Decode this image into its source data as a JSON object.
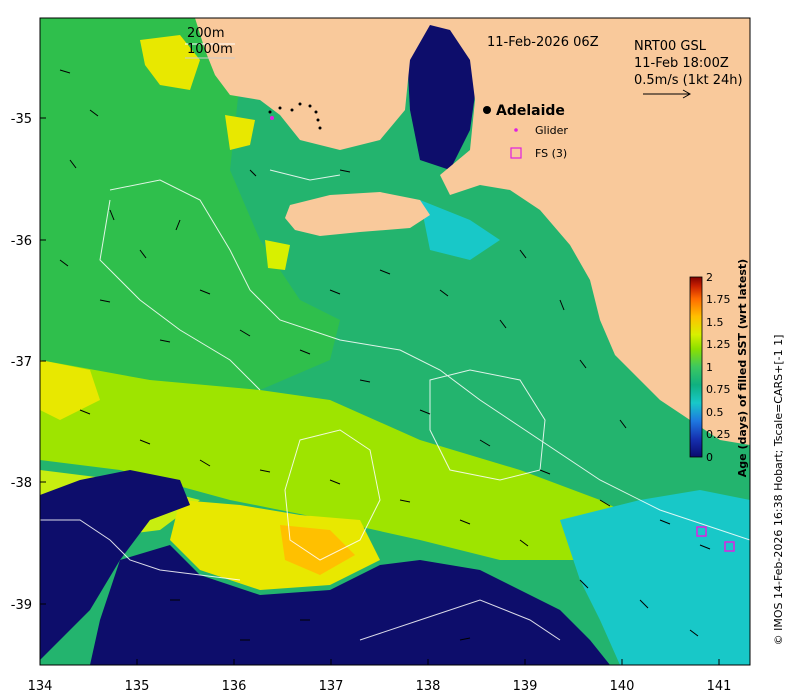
{
  "map": {
    "title_date": "11-Feb-2026 06Z",
    "product": "NRT00 GSL",
    "product_time": "11-Feb 18:00Z",
    "vector_scale": "0.5m/s (1kt 24h)",
    "contour_labels": [
      "200m",
      "1000m"
    ],
    "place": "Adelaide",
    "legend": {
      "glider": "Glider",
      "fs": "FS (3)"
    },
    "credit": "© IMOS 14-Feb-2026 16:38 Hobart; Tscale=CARS+[-1 1]",
    "x_ticks": [
      "134",
      "135",
      "136",
      "137",
      "138",
      "139",
      "140",
      "141"
    ],
    "y_ticks": [
      "-35",
      "-36",
      "-37",
      "-38",
      "-39"
    ],
    "colorbar": {
      "label": "Age (days) of filled SST (wrt latest)",
      "ticks": [
        "2",
        "1.75",
        "1.5",
        "1.25",
        "1",
        "0.75",
        "0.5",
        "0.25",
        "0"
      ],
      "colors": [
        "#7f0000",
        "#c82000",
        "#ff6a00",
        "#ffc000",
        "#d8f000",
        "#8be000",
        "#3cc860",
        "#0fb080",
        "#18c8c8",
        "#1e78e0",
        "#1530b0",
        "#0a0a6e"
      ]
    },
    "colors": {
      "land": "#f9c99b",
      "deep_blue": "#0d0d6b",
      "teal": "#23b46e"
    }
  }
}
